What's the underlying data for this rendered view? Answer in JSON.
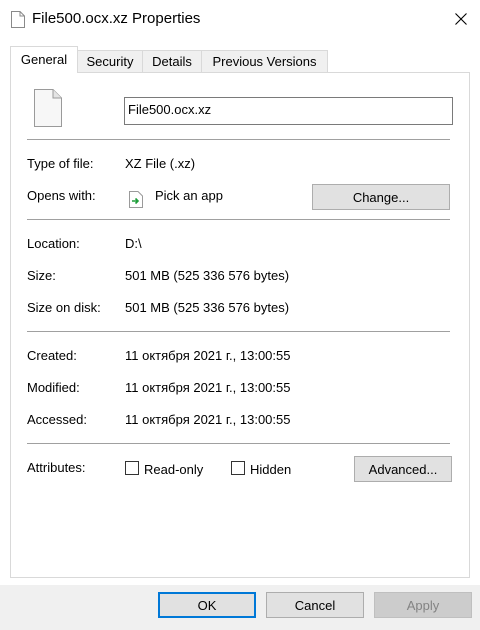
{
  "window": {
    "title": "File500.ocx.xz Properties",
    "close_icon": "close-icon"
  },
  "tabs": [
    {
      "label": "General",
      "active": true
    },
    {
      "label": "Security",
      "active": false
    },
    {
      "label": "Details",
      "active": false
    },
    {
      "label": "Previous Versions",
      "active": false
    }
  ],
  "general": {
    "filename": "File500.ocx.xz",
    "type_label": "Type of file:",
    "type_value": "XZ File (.xz)",
    "opens_label": "Opens with:",
    "opens_value": "Pick an app",
    "change_button": "Change...",
    "location_label": "Location:",
    "location_value": "D:\\",
    "size_label": "Size:",
    "size_value": "501 MB (525 336 576 bytes)",
    "size_disk_label": "Size on disk:",
    "size_disk_value": "501 MB (525 336 576 bytes)",
    "created_label": "Created:",
    "created_value": "11 октября 2021 г., 13:00:55",
    "modified_label": "Modified:",
    "modified_value": "11 октября 2021 г., 13:00:55",
    "accessed_label": "Accessed:",
    "accessed_value": "11 октября 2021 г., 13:00:55",
    "attributes_label": "Attributes:",
    "readonly_label": "Read-only",
    "readonly_checked": false,
    "hidden_label": "Hidden",
    "hidden_checked": false,
    "advanced_button": "Advanced..."
  },
  "footer": {
    "ok": "OK",
    "cancel": "Cancel",
    "apply": "Apply"
  },
  "colors": {
    "accent": "#0078d7",
    "pick_app_arrow": "#1f9e3a"
  }
}
